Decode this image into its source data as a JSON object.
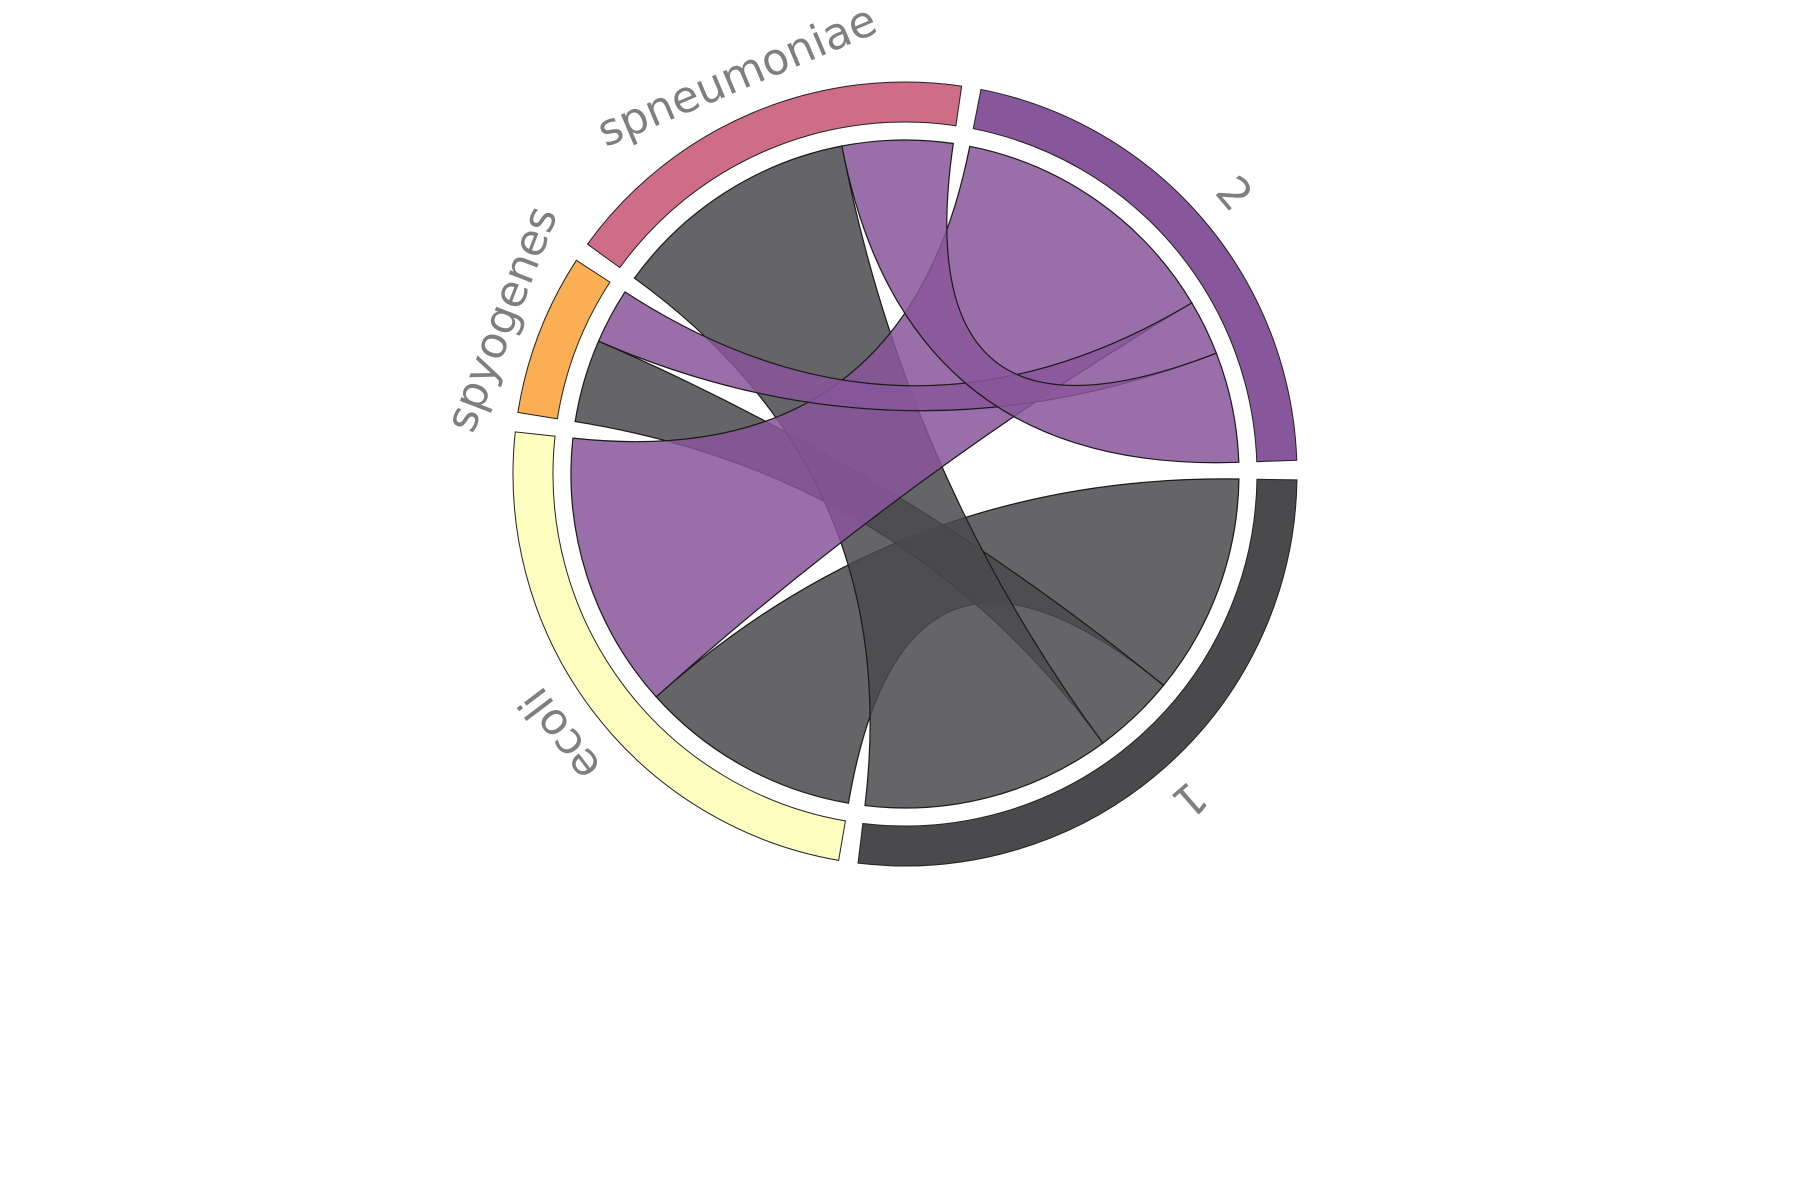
{
  "chart_data": {
    "type": "chord",
    "nodes": [
      {
        "name": "1",
        "color": "#4a4a4c",
        "value": 10
      },
      {
        "name": "ecoli",
        "color": "#fcfdbf",
        "value": 9
      },
      {
        "name": "spyogenes",
        "color": "#fbaf54",
        "value": 2.5
      },
      {
        "name": "spneumoniae",
        "color": "#cf6d87",
        "value": 6.5
      },
      {
        "name": "2",
        "color": "#88569a",
        "value": 8
      }
    ],
    "links": [
      {
        "source": "1",
        "target": "ecoli",
        "value": 4,
        "color": "#4a4a4c"
      },
      {
        "source": "1",
        "target": "spyogenes",
        "value": 1.5,
        "color": "#4a4a4c"
      },
      {
        "source": "1",
        "target": "spneumoniae",
        "value": 4.5,
        "color": "#4a4a4c"
      },
      {
        "source": "2",
        "target": "ecoli",
        "value": 5,
        "color": "#88569a"
      },
      {
        "source": "2",
        "target": "spyogenes",
        "value": 1,
        "color": "#88569a"
      },
      {
        "source": "2",
        "target": "spneumoniae",
        "value": 2,
        "color": "#88569a"
      }
    ]
  }
}
